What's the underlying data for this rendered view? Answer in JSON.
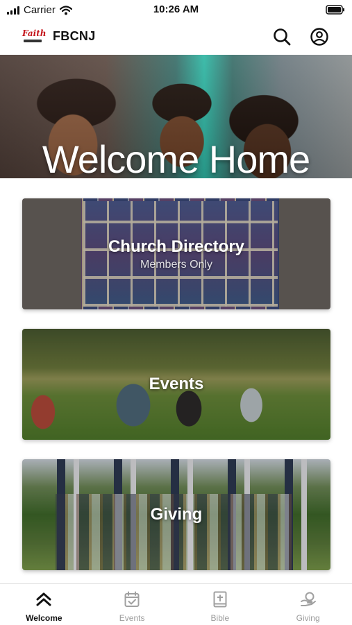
{
  "status_bar": {
    "carrier": "Carrier",
    "time": "10:26 AM"
  },
  "header": {
    "logo_text": "Faith",
    "title": "FBCNJ",
    "icons": [
      "search-icon",
      "account-icon"
    ]
  },
  "hero": {
    "title": "Welcome Home"
  },
  "cards": [
    {
      "title": "Church Directory",
      "subtitle": "Members Only"
    },
    {
      "title": "Events"
    },
    {
      "title": "Giving"
    }
  ],
  "tabs": [
    {
      "label": "Welcome",
      "icon": "double-chevron-up-icon",
      "active": true
    },
    {
      "label": "Events",
      "icon": "calendar-check-icon",
      "active": false
    },
    {
      "label": "Bible",
      "icon": "bible-cross-icon",
      "active": false
    },
    {
      "label": "Giving",
      "icon": "giving-hand-icon",
      "active": false
    }
  ],
  "colors": {
    "accent": "#111111",
    "inactive_tab": "#9a9a9a",
    "logo_red": "#c4161c"
  }
}
